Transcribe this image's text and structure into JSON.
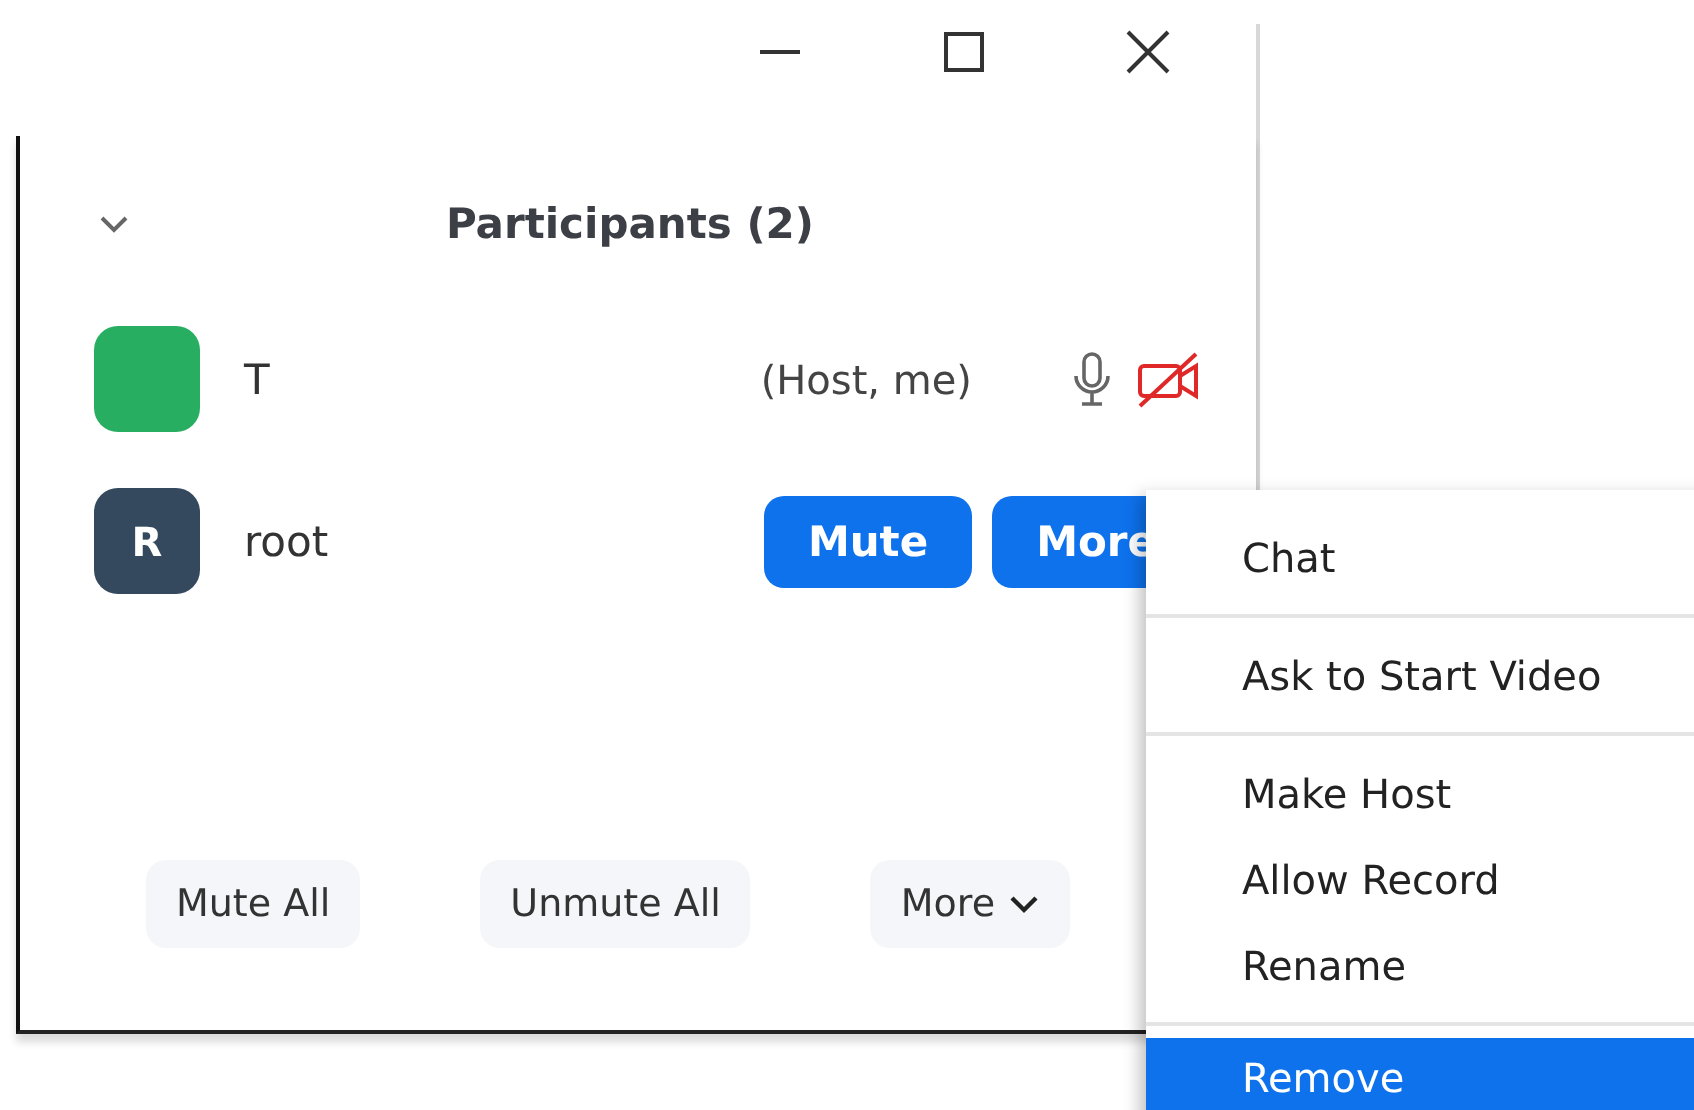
{
  "window": {
    "controls": [
      {
        "kind": "minimize"
      },
      {
        "kind": "maximize"
      },
      {
        "kind": "close"
      }
    ]
  },
  "panel": {
    "title": "Participants (2)",
    "collapsed": false
  },
  "participants": [
    {
      "name": "T",
      "color": "#27ae60",
      "role": "(Host, me)",
      "muted": false,
      "video_on": false
    },
    {
      "name": "root",
      "initial": "R",
      "color": "#34495e",
      "buttons": [
        "Mute",
        "More"
      ]
    }
  ],
  "footer": [
    {
      "label": "Mute All",
      "dropdown": false
    },
    {
      "label": "Unmute All",
      "dropdown": false
    },
    {
      "label": "More",
      "dropdown": true
    }
  ],
  "menu": {
    "groups": [
      [
        {
          "label": "Chat",
          "selected": false
        }
      ],
      [
        {
          "label": "Ask to Start Video",
          "selected": false
        }
      ],
      [
        {
          "label": "Make Host",
          "selected": false
        },
        {
          "label": "Allow Record",
          "selected": false
        },
        {
          "label": "Rename",
          "selected": false
        }
      ],
      [
        {
          "label": "Remove",
          "selected": true
        }
      ]
    ]
  }
}
